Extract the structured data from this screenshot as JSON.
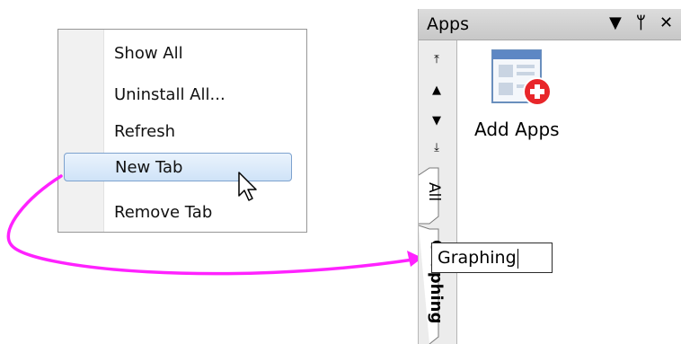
{
  "context_menu": {
    "items": [
      {
        "label": "Show All"
      },
      {
        "label": "Uninstall All..."
      },
      {
        "label": "Refresh"
      },
      {
        "label": "New Tab"
      },
      {
        "label": "Remove Tab"
      }
    ],
    "highlighted_index": 3
  },
  "apps_panel": {
    "title": "Apps",
    "header_buttons": [
      {
        "icon": "dropdown-triangle-icon",
        "glyph": "▼"
      },
      {
        "icon": "pin-icon",
        "glyph": "ᛘ"
      },
      {
        "icon": "close-icon",
        "glyph": "✕"
      }
    ],
    "nav_arrows": [
      {
        "icon": "scroll-top-icon",
        "glyph": "⤒"
      },
      {
        "icon": "scroll-up-icon",
        "glyph": "▲"
      },
      {
        "icon": "scroll-down-icon",
        "glyph": "▼"
      },
      {
        "icon": "scroll-bottom-icon",
        "glyph": "⤓"
      }
    ],
    "tabs": [
      {
        "label": "All"
      },
      {
        "label": "Graphing"
      }
    ],
    "add_apps": {
      "label": "Add Apps",
      "icon": "add-apps-icon"
    },
    "rename_input": {
      "value": "Graphing"
    }
  },
  "colors": {
    "arrow": "#ff22ff",
    "highlight_border": "#7da2ce",
    "add_badge": "#e8262a"
  }
}
